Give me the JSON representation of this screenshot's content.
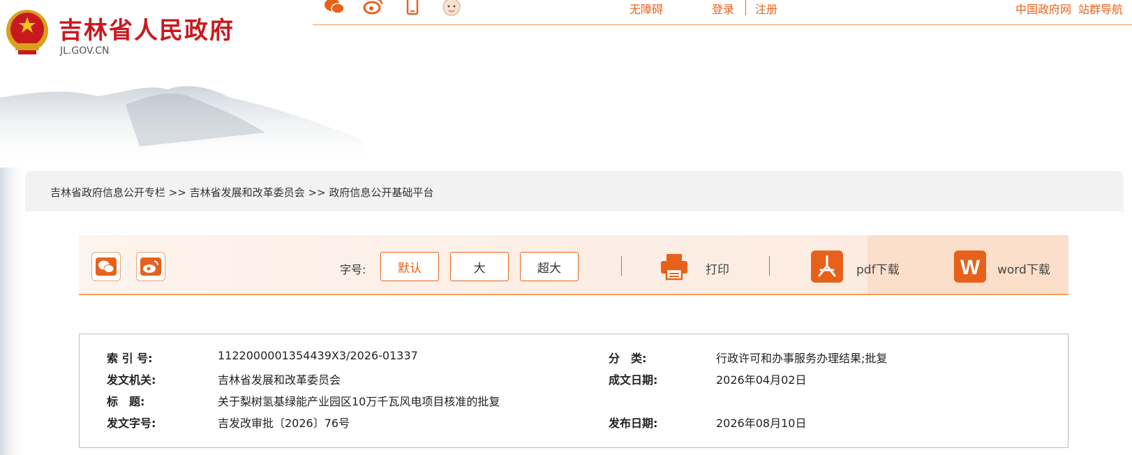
{
  "header": {
    "site_title": "吉林省人民政府",
    "site_domain": "JL.GOV.CN",
    "accessibility": "无障碍",
    "login": "登录",
    "register": "注册",
    "china_gov": "中国政府网",
    "site_nav": "站群导航"
  },
  "breadcrumb": "吉林省政府信息公开专栏 >> 吉林省发展和改革委员会 >> 政府信息公开基础平台",
  "toolbar": {
    "font_label": "字号:",
    "font_default": "默认",
    "font_large": "大",
    "font_xlarge": "超大",
    "print": "打印",
    "pdf_download": "pdf下载",
    "word_download": "word下载"
  },
  "meta": {
    "index_key": "索 引 号:",
    "index_val": "1122000001354439X3/2026-01337",
    "category_key": "分　类:",
    "category_val": "行政许可和办事服务办理结果;批复",
    "issuer_key": "发文机关:",
    "issuer_val": "吉林省发展和改革委员会",
    "date_written_key": "成文日期:",
    "date_written_val": "2026年04月02日",
    "title_key": "标　题:",
    "title_val": "关于梨树氢基绿能产业园区10万千瓦风电项目核准的批复",
    "doc_no_key": "发文字号:",
    "doc_no_val": "吉发改审批〔2026〕76号",
    "publish_date_key": "发布日期:",
    "publish_date_val": "2026年08月10日"
  },
  "colors": {
    "brand_red": "#c8191e",
    "accent_orange": "#e8611a"
  }
}
